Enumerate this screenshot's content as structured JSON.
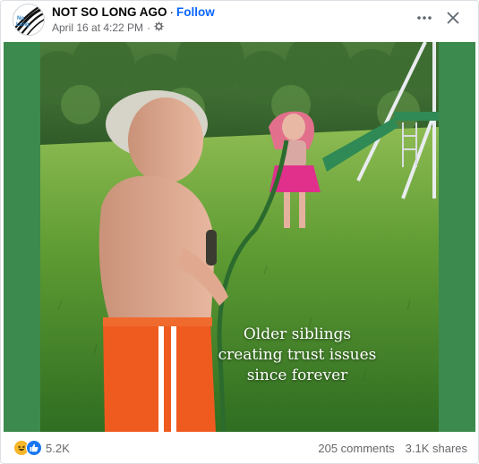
{
  "post": {
    "page_name": "NOT SO LONG AGO",
    "separator": "·",
    "follow_label": "Follow",
    "timestamp": "April 16 at 4:22 PM",
    "meta_separator": "·",
    "audience_icon": "gear-icon",
    "more_icon": "more-horizontal-icon",
    "close_icon": "close-icon"
  },
  "media": {
    "caption_line1": "Older siblings",
    "caption_line2": "creating trust issues",
    "caption_line3": "since forever",
    "background_color": "#3c8a4d"
  },
  "footer": {
    "reaction_icons": [
      "laugh-emoji-icon",
      "like-icon"
    ],
    "reaction_count": "5.2K",
    "comments": "205 comments",
    "shares": "3.1K shares"
  },
  "colors": {
    "accent": "#0866ff",
    "secondary_text": "#65676b"
  }
}
